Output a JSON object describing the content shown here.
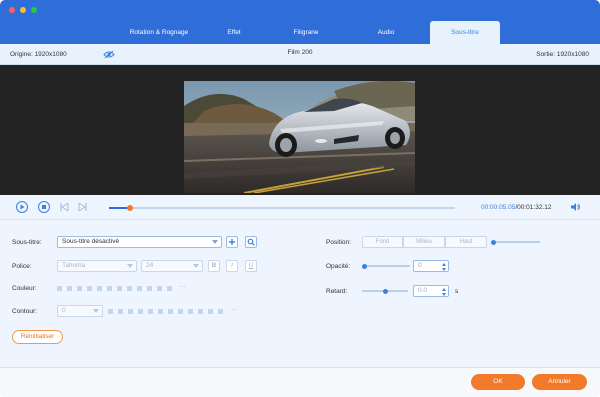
{
  "window": {
    "traffic_colors": [
      "#ff5f57",
      "#febc2e",
      "#28c840"
    ]
  },
  "tabs": [
    {
      "label": "Rotation & Rognage",
      "active": false
    },
    {
      "label": "Effet",
      "active": false
    },
    {
      "label": "Filigrane",
      "active": false
    },
    {
      "label": "Audio",
      "active": false
    },
    {
      "label": "Sous-titre",
      "active": true
    }
  ],
  "infobar": {
    "origin": "Origine: 1920x1080",
    "title": "Film 200",
    "output": "Sortie: 1920x1080",
    "eye_icon": "eye-icon"
  },
  "playback": {
    "current_time": "00:00:05.05",
    "total_time": "/00:01:32.12",
    "progress": 0.06
  },
  "subtitle": {
    "label": "Sous-titre:",
    "value": "Sous-titre désactivé",
    "add_icon": "plus-icon",
    "search_icon": "search-icon"
  },
  "font": {
    "label": "Police:",
    "family": "Tahoma",
    "size": "24",
    "bold": "B",
    "italic": "I",
    "underline": "U"
  },
  "color": {
    "label": "Couleur:",
    "more": "···"
  },
  "outline": {
    "label": "Contour:",
    "value": "0",
    "more": "···"
  },
  "position": {
    "label": "Position:",
    "options": [
      "Fond",
      "Milieu",
      "Haut"
    ]
  },
  "opacity": {
    "label": "Opacité:",
    "value": "0",
    "level": 0.0
  },
  "delay": {
    "label": "Retard:",
    "value": "0.0",
    "unit": "s",
    "level": 0.5
  },
  "reset_label": "Réinitialiser",
  "buttons": {
    "ok": "OK",
    "cancel": "Annuler"
  },
  "colors": {
    "accent": "#3b82e0",
    "titlebar": "#2f6ed8",
    "orange": "#f27a2a"
  }
}
